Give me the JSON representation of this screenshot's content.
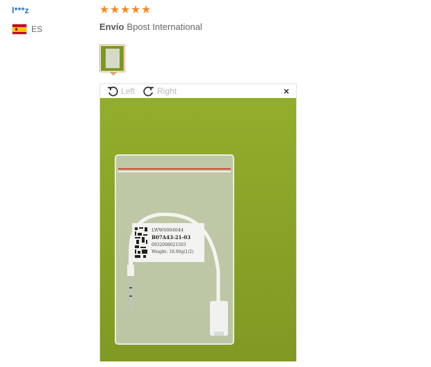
{
  "review": {
    "user_name": "l***z",
    "country_code": "ES",
    "rating": 5,
    "stars": [
      "★",
      "★",
      "★",
      "★",
      "★"
    ],
    "shipping_label": "Envío",
    "shipping_method": "Bpost International"
  },
  "viewer": {
    "rotate_left_label": "Left",
    "rotate_right_label": "Right",
    "close_label": "×"
  },
  "photo_label": {
    "line1": "LWW6004044",
    "line2": "B07A43-21-03",
    "line3": "0932008021503",
    "line4": "Weight: 18.00g(1/2)"
  },
  "colors": {
    "accent_star": "#f5881f",
    "user_link": "#1f6fb2",
    "thumb_border": "#e5a57a",
    "photo_background": "#8aa428"
  }
}
